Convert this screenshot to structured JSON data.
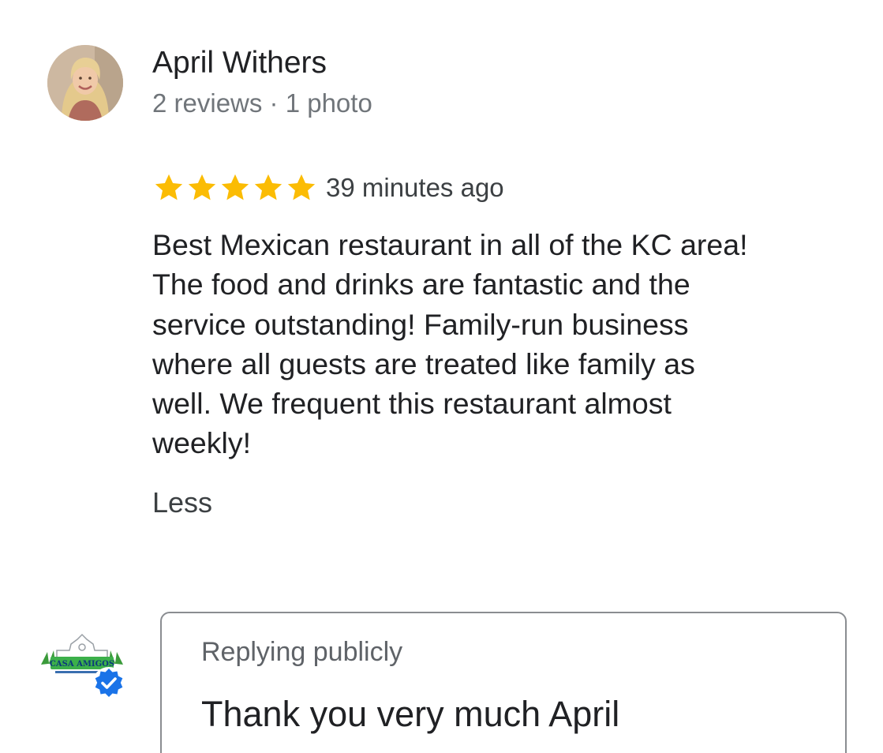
{
  "reviewer": {
    "name": "April Withers",
    "meta": "2 reviews · 1 photo",
    "avatar_icon": "user-photo-avatar"
  },
  "review": {
    "rating": 5,
    "rating_max": 5,
    "star_color": "#fbbc04",
    "time": "39 minutes ago",
    "body": "Best Mexican restaurant in all of the KC area!\nThe food and drinks are fantastic and the\nservice outstanding!  Family-run business\nwhere all guests are treated like family as\nwell.  We frequent this restaurant almost\nweekly!",
    "less_label": "Less"
  },
  "owner": {
    "logo_text": "CASA AMIGOS",
    "logo_icon": "business-logo",
    "verified_icon": "verified-badge-icon",
    "verified_color": "#1a73e8"
  },
  "reply": {
    "label": "Replying publicly",
    "text": "Thank you very much April"
  }
}
